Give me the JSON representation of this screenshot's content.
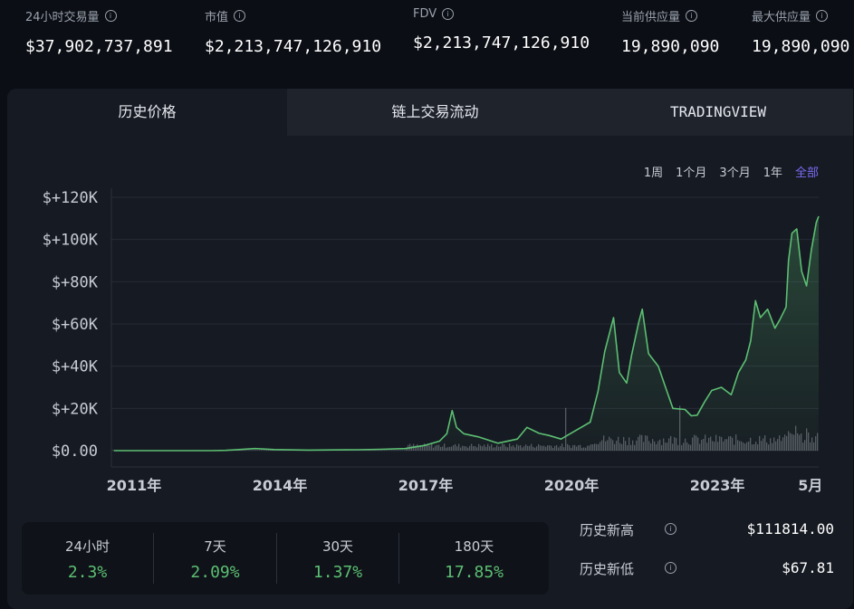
{
  "top_stats": [
    {
      "label": "24小时交易量",
      "value": "$37,902,737,891"
    },
    {
      "label": "市值",
      "value": "$2,213,747,126,910"
    },
    {
      "label": "FDV",
      "value": "$2,213,747,126,910"
    },
    {
      "label": "当前供应量",
      "value": "19,890,090"
    },
    {
      "label": "最大供应量",
      "value": "19,890,090"
    }
  ],
  "tabs": [
    {
      "label": "历史价格"
    },
    {
      "label": "链上交易流动"
    },
    {
      "label": "TRADINGVIEW"
    }
  ],
  "ranges": [
    {
      "label": "1周"
    },
    {
      "label": "1个月"
    },
    {
      "label": "3个月"
    },
    {
      "label": "1年"
    },
    {
      "label": "全部"
    }
  ],
  "colors": {
    "price_line": "#5cbf73",
    "accent": "#7b6cf6",
    "volume": "#8a8f99"
  },
  "chart_data": {
    "type": "area",
    "y_ticks": [
      "$+120K",
      "$+100K",
      "$+80K",
      "$+60K",
      "$+40K",
      "$+20K",
      "$0.00"
    ],
    "ylim": [
      0,
      120000
    ],
    "x_ticks": [
      {
        "label": "2011年",
        "t": 2011.0
      },
      {
        "label": "2014年",
        "t": 2014.0
      },
      {
        "label": "2017年",
        "t": 2017.0
      },
      {
        "label": "2020年",
        "t": 2020.0
      },
      {
        "label": "2023年",
        "t": 2023.0
      },
      {
        "label": "5月",
        "t": 2025.33
      }
    ],
    "xlim": [
      2010.95,
      2025.5
    ],
    "grid": true,
    "series": [
      {
        "points": [
          [
            2011.0,
            1
          ],
          [
            2011.5,
            15
          ],
          [
            2012.5,
            10
          ],
          [
            2013.0,
            13
          ],
          [
            2013.3,
            120
          ],
          [
            2013.9,
            1000
          ],
          [
            2014.3,
            500
          ],
          [
            2015.0,
            250
          ],
          [
            2016.0,
            430
          ],
          [
            2016.5,
            650
          ],
          [
            2017.0,
            1000
          ],
          [
            2017.4,
            2500
          ],
          [
            2017.7,
            4500
          ],
          [
            2017.85,
            8000
          ],
          [
            2017.96,
            19000
          ],
          [
            2018.05,
            11000
          ],
          [
            2018.2,
            8000
          ],
          [
            2018.5,
            6500
          ],
          [
            2018.9,
            3500
          ],
          [
            2019.3,
            5500
          ],
          [
            2019.5,
            11000
          ],
          [
            2019.75,
            8200
          ],
          [
            2019.95,
            7200
          ],
          [
            2020.2,
            5500
          ],
          [
            2020.5,
            9500
          ],
          [
            2020.8,
            13500
          ],
          [
            2020.96,
            28000
          ],
          [
            2021.1,
            47000
          ],
          [
            2021.28,
            63000
          ],
          [
            2021.4,
            37000
          ],
          [
            2021.55,
            32000
          ],
          [
            2021.65,
            45000
          ],
          [
            2021.8,
            61000
          ],
          [
            2021.87,
            67000
          ],
          [
            2022.0,
            46000
          ],
          [
            2022.2,
            40000
          ],
          [
            2022.35,
            30000
          ],
          [
            2022.5,
            20000
          ],
          [
            2022.75,
            19500
          ],
          [
            2022.88,
            16500
          ],
          [
            2023.0,
            16800
          ],
          [
            2023.15,
            23000
          ],
          [
            2023.3,
            28500
          ],
          [
            2023.5,
            30000
          ],
          [
            2023.7,
            26500
          ],
          [
            2023.85,
            37000
          ],
          [
            2024.0,
            43000
          ],
          [
            2024.1,
            52000
          ],
          [
            2024.2,
            71000
          ],
          [
            2024.3,
            63000
          ],
          [
            2024.45,
            67000
          ],
          [
            2024.6,
            58000
          ],
          [
            2024.7,
            62000
          ],
          [
            2024.83,
            68000
          ],
          [
            2024.88,
            90000
          ],
          [
            2024.95,
            103000
          ],
          [
            2025.05,
            105000
          ],
          [
            2025.15,
            85000
          ],
          [
            2025.25,
            78000
          ],
          [
            2025.35,
            95000
          ],
          [
            2025.45,
            108000
          ],
          [
            2025.5,
            111000
          ]
        ]
      }
    ]
  },
  "changes": [
    {
      "period": "24小时",
      "value": "2.3%"
    },
    {
      "period": "7天",
      "value": "2.09%"
    },
    {
      "period": "30天",
      "value": "1.37%"
    },
    {
      "period": "180天",
      "value": "17.85%"
    }
  ],
  "ath": {
    "label": "历史新高",
    "value": "$111814.00"
  },
  "atl": {
    "label": "历史新低",
    "value": "$67.81"
  }
}
